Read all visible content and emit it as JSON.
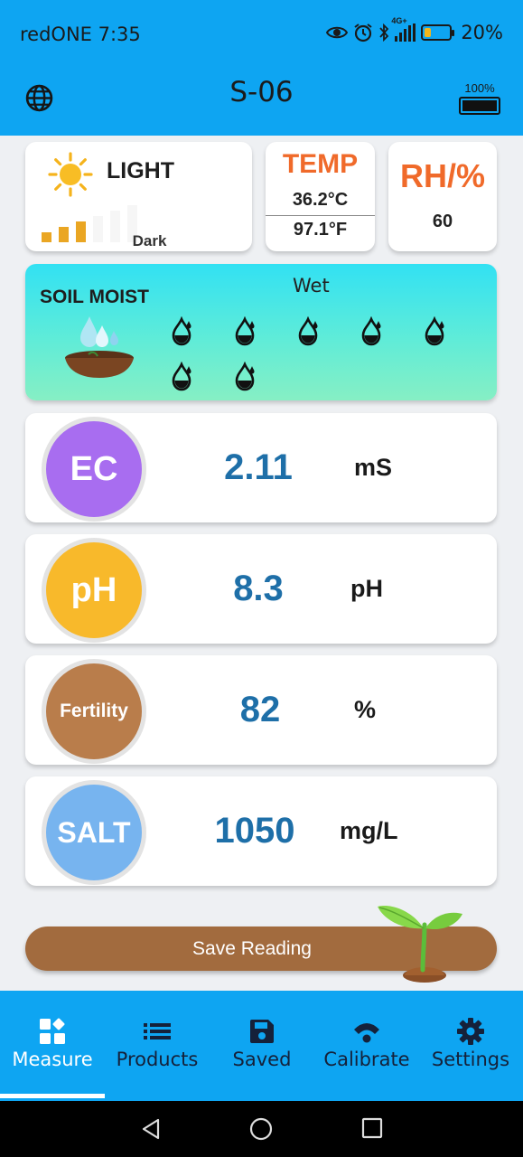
{
  "status_bar": {
    "carrier_time": "redONE 7:35",
    "network_label": "4G+",
    "battery_percent": "20%",
    "battery_level": 0.2,
    "icons": [
      "eye-icon",
      "alarm-icon",
      "bluetooth-icon",
      "signal-icon",
      "battery-icon"
    ]
  },
  "app_bar": {
    "title": "S-06",
    "globe_icon": "globe-icon",
    "device_battery_percent": "100%",
    "device_battery_level": 1.0
  },
  "light": {
    "title": "LIGHT",
    "value": "Dark",
    "icon": "sun-icon",
    "level_bars_on": 3,
    "level_bars_total": 6
  },
  "temp": {
    "title": "TEMP",
    "celsius": "36.2°C",
    "fahrenheit": "97.1°F"
  },
  "rh": {
    "title": "RH/%",
    "value": "60"
  },
  "soil": {
    "title": "SOIL MOIST",
    "status": "Wet",
    "drop_count": 7,
    "icon": "water-drop-icon"
  },
  "measurements": [
    {
      "key": "ec",
      "label": "EC",
      "value": "2.11",
      "unit": "mS",
      "color": "#a86df0"
    },
    {
      "key": "ph",
      "label": "pH",
      "value": "8.3",
      "unit": "pH",
      "color": "#f8b92b"
    },
    {
      "key": "fertility",
      "label": "Fertility",
      "value": "82",
      "unit": "%",
      "color": "#b97d4b"
    },
    {
      "key": "salt",
      "label": "SALT",
      "value": "1050",
      "unit": "mg/L",
      "color": "#77b4ef"
    }
  ],
  "save_button": {
    "label": "Save Reading",
    "color": "#a26b3e"
  },
  "nav": {
    "items": [
      {
        "label": "Measure",
        "icon": "measure-icon",
        "active": true
      },
      {
        "label": "Products",
        "icon": "list-icon",
        "active": false
      },
      {
        "label": "Saved",
        "icon": "save-icon",
        "active": false
      },
      {
        "label": "Calibrate",
        "icon": "wifi-icon",
        "active": false
      },
      {
        "label": "Settings",
        "icon": "gear-icon",
        "active": false
      }
    ]
  },
  "colors": {
    "primary": "#0ea5f2",
    "value_blue": "#1e6fa8",
    "accent_orange": "#f06a2a"
  }
}
